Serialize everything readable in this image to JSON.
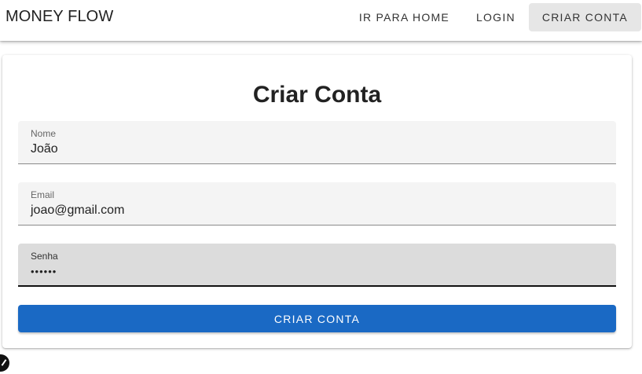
{
  "app": {
    "brand": "MONEY FLOW"
  },
  "nav": {
    "items": [
      {
        "label": "IR PARA HOME",
        "active": false
      },
      {
        "label": "LOGIN",
        "active": false
      },
      {
        "label": "CRIAR CONTA",
        "active": true
      }
    ]
  },
  "form": {
    "title": "Criar Conta",
    "fields": [
      {
        "label": "Nome",
        "value": "João"
      },
      {
        "label": "Email",
        "value": "joao@gmail.com"
      },
      {
        "label": "Senha",
        "value": "••••••"
      }
    ],
    "submit_label": "CRIAR CONTA"
  },
  "colors": {
    "primary": "#1a69c4",
    "active_nav_bg": "#e6e6e6",
    "focused_field_bg": "#dcdcdc"
  }
}
